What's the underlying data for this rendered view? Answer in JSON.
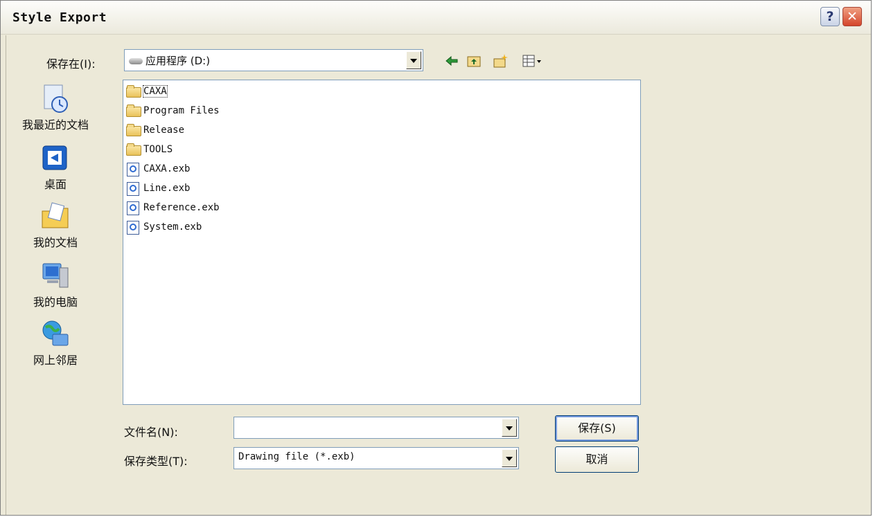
{
  "dialog": {
    "title": "Style Export",
    "help_label": "?",
    "close_label": "✕"
  },
  "save_in": {
    "label": "保存在(I):",
    "value": "应用程序 (D:)"
  },
  "toolbar": {
    "icons": [
      "back-icon",
      "up-folder-icon",
      "new-folder-icon",
      "view-menu-icon"
    ]
  },
  "places": [
    {
      "label": "我最近的文档",
      "icon": "recent-documents-icon"
    },
    {
      "label": "桌面",
      "icon": "desktop-icon"
    },
    {
      "label": "我的文档",
      "icon": "my-documents-icon"
    },
    {
      "label": "我的电脑",
      "icon": "my-computer-icon"
    },
    {
      "label": "网上邻居",
      "icon": "network-places-icon"
    }
  ],
  "files": [
    {
      "name": "CAXA",
      "type": "folder"
    },
    {
      "name": "Program Files",
      "type": "folder"
    },
    {
      "name": "Release",
      "type": "folder"
    },
    {
      "name": "TOOLS",
      "type": "folder"
    },
    {
      "name": "CAXA.exb",
      "type": "exb"
    },
    {
      "name": "Line.exb",
      "type": "exb"
    },
    {
      "name": "Reference.exb",
      "type": "exb"
    },
    {
      "name": "System.exb",
      "type": "exb"
    }
  ],
  "filename": {
    "label": "文件名(N):",
    "value": ""
  },
  "filetype": {
    "label": "保存类型(T):",
    "value": "Drawing file (*.exb)"
  },
  "buttons": {
    "save": "保存(S)",
    "cancel": "取消"
  }
}
